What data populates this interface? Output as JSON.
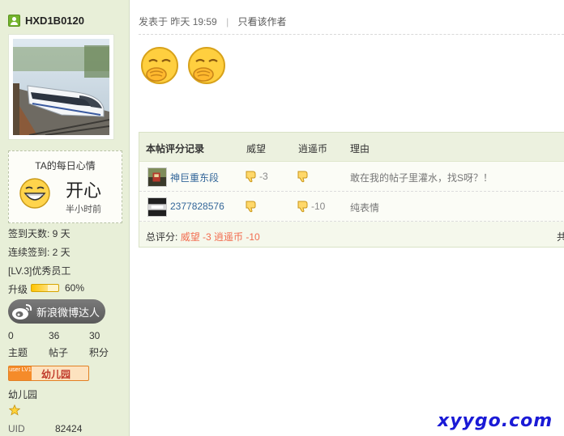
{
  "user": {
    "username": "HXD1B0120",
    "mood_title": "TA的每日心情",
    "mood": "开心",
    "mood_time": "半小时前",
    "signin_days": "签到天数: 9 天",
    "streak_days": "连续签到: 2 天",
    "level_title": "[LV.3]优秀员工",
    "upgrade_label": "升级",
    "upgrade_progress": 0.6,
    "upgrade_percent": "60%",
    "weibo_badge": "新浪微博达人",
    "stats": [
      {
        "value": "0",
        "label": "主题"
      },
      {
        "value": "36",
        "label": "帖子"
      },
      {
        "value": "30",
        "label": "积分"
      }
    ],
    "group_badge_lv": "user LV1",
    "group_badge": "幼儿园",
    "group_name": "幼儿园",
    "uid_label": "UID",
    "uid": "82424"
  },
  "post": {
    "posted_prefix": "发表于",
    "posted_time": "昨天 19:59",
    "only_author": "只看该作者",
    "emoji_count": 2
  },
  "rating": {
    "headers": [
      "本帖评分记录",
      "威望",
      "逍遥币",
      "理由"
    ],
    "rows": [
      {
        "user": "神巨重东段",
        "prestige": "-3",
        "coin": "",
        "reason": "敢在我的帖子里灌水，找S呀？！"
      },
      {
        "user": "2377828576",
        "prestige": "",
        "coin": "-10",
        "reason": "纯表情"
      }
    ],
    "total_label": "总评分:",
    "total_prestige": "威望 -3",
    "total_coin": "逍遥币 -10",
    "right_cut": "共"
  },
  "watermark": "xyygo.com",
  "colors": {
    "sidebar_bg": "#e8efd8",
    "link": "#336699",
    "highlight": "#f26c4f",
    "watermark": "#1a1ad6"
  }
}
